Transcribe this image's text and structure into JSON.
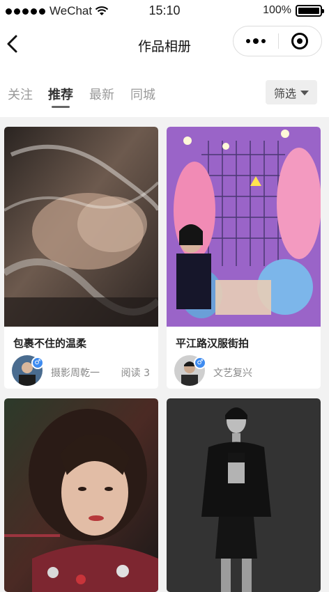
{
  "status_bar": {
    "carrier": "WeChat",
    "time": "15:10",
    "battery": "100%"
  },
  "nav": {
    "title": "作品相册"
  },
  "tabs": [
    {
      "label": "关注",
      "active": false
    },
    {
      "label": "推荐",
      "active": true
    },
    {
      "label": "最新",
      "active": false
    },
    {
      "label": "同城",
      "active": false
    }
  ],
  "filter": {
    "label": "筛选"
  },
  "cards": [
    {
      "title": "包裹不住的温柔",
      "author": "摄影周乾一",
      "reads": "阅读 3"
    },
    {
      "title": "平江路汉服街拍",
      "author": "文艺复兴"
    },
    {
      "title": ""
    },
    {
      "title": ""
    }
  ],
  "colors": {
    "gender_badge": "#3f8cf0",
    "active_tab": "#333333",
    "inactive_tab": "#999999"
  }
}
